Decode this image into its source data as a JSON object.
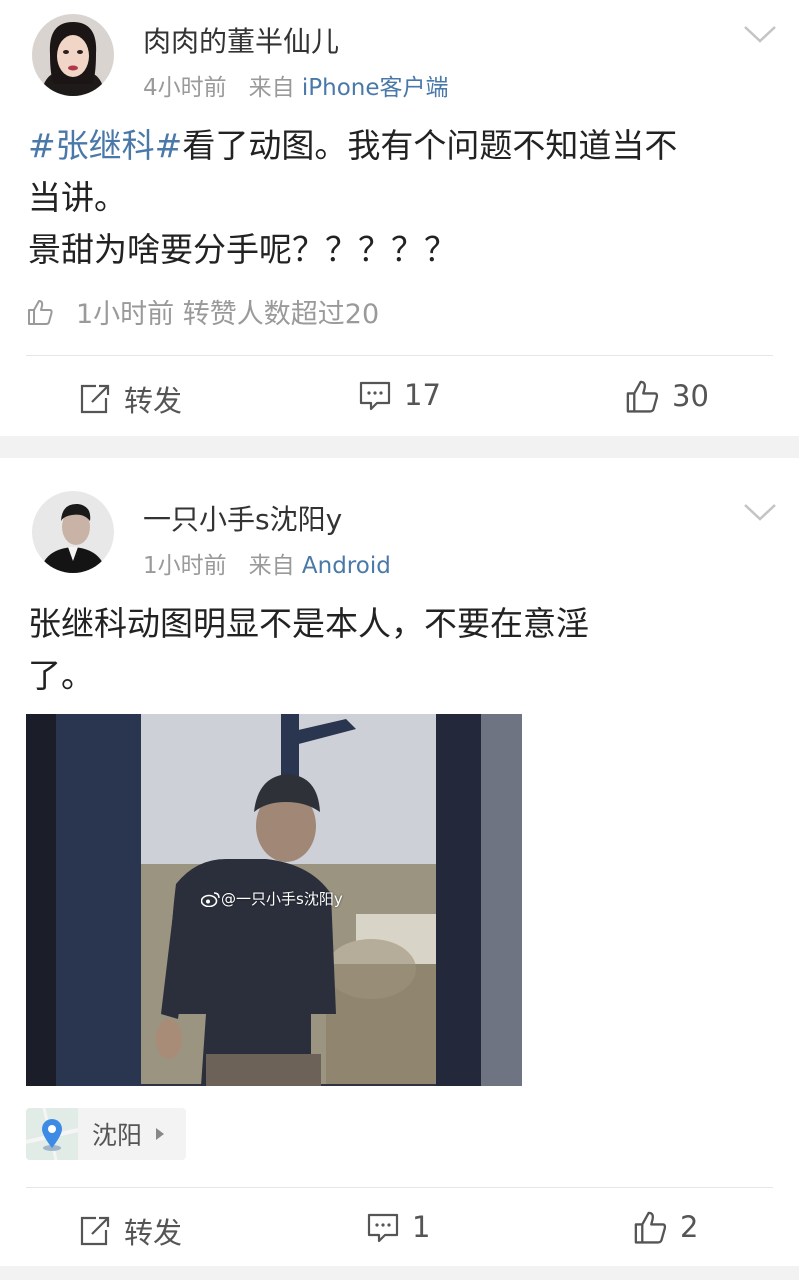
{
  "posts": [
    {
      "username": "肉肉的董半仙儿",
      "time": "4小时前",
      "source_prefix": "来自",
      "source": "iPhone客户端",
      "hashtag": "#张继科#",
      "text_line1": "看了动图。我有个问题不知道当不",
      "text_line2": "当讲。",
      "text_line3": "景甜为啥要分手呢？？？？？",
      "like_info": "1小时前 转赞人数超过20",
      "actions": {
        "repost": "转发",
        "comments": "17",
        "likes": "30"
      }
    },
    {
      "username": "一只小手s沈阳y",
      "time": "1小时前",
      "source_prefix": "来自",
      "source": "Android",
      "text_line1": "张继科动图明显不是本人，不要在意淫",
      "text_line2": "了。",
      "watermark": "@一只小手s沈阳y",
      "location": "沈阳",
      "actions": {
        "repost": "转发",
        "comments": "1",
        "likes": "2"
      }
    }
  ],
  "colors": {
    "link": "#4a78a8",
    "meta": "#9a9a9a",
    "divider": "#e6e6e6",
    "background": "#f2f2f2"
  },
  "icons": [
    "avatar",
    "chevron-down-icon",
    "thumbs-up-icon",
    "repost-icon",
    "comment-icon",
    "weibo-logo-icon",
    "location-pin-icon",
    "caret-right-icon"
  ]
}
